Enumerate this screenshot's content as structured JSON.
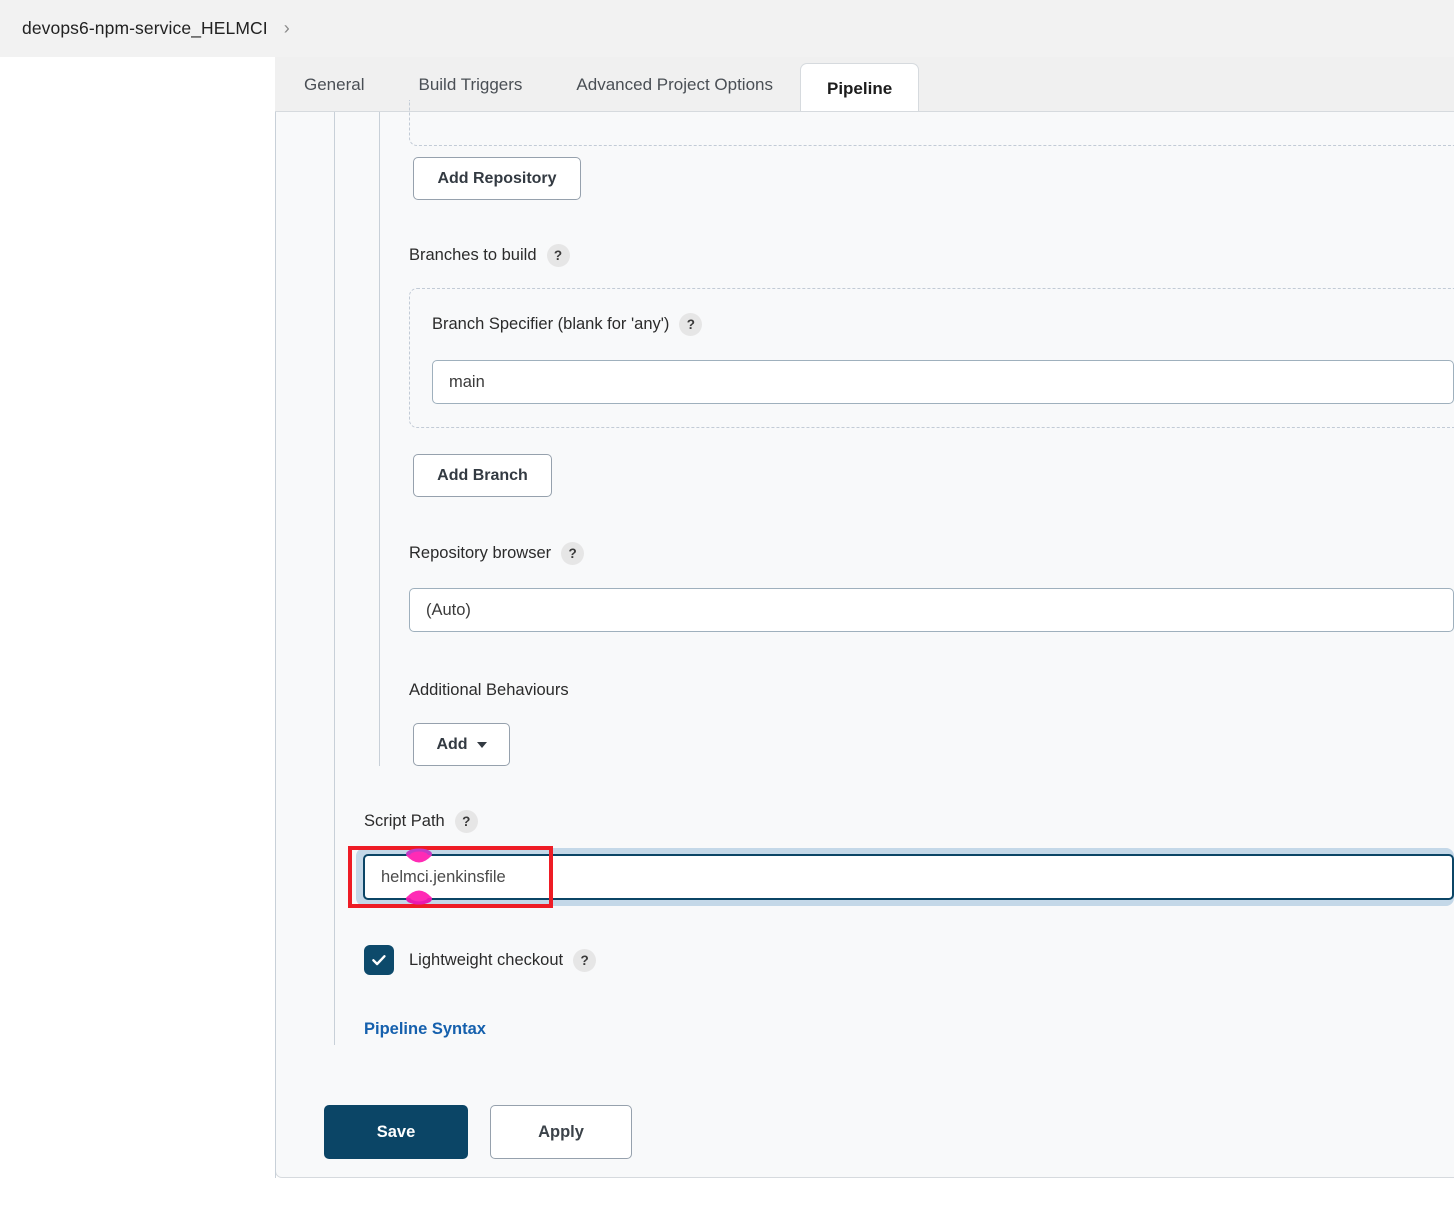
{
  "breadcrumb": {
    "item": "devops6-npm-service_HELMCI",
    "separator": "›"
  },
  "tabs": [
    {
      "label": "General",
      "active": false
    },
    {
      "label": "Build Triggers",
      "active": false
    },
    {
      "label": "Advanced Project Options",
      "active": false
    },
    {
      "label": "Pipeline",
      "active": true
    }
  ],
  "form": {
    "add_repository_label": "Add Repository",
    "branches_to_build_label": "Branches to build",
    "branch_specifier_label": "Branch Specifier (blank for 'any')",
    "branch_specifier_value": "main",
    "add_branch_label": "Add Branch",
    "repository_browser_label": "Repository browser",
    "repository_browser_value": "(Auto)",
    "additional_behaviours_label": "Additional Behaviours",
    "add_behaviour_label": "Add",
    "script_path_label": "Script Path",
    "script_path_value": "helmci.jenkinsfile",
    "lightweight_checkout_label": "Lightweight checkout",
    "lightweight_checkout_checked": true,
    "pipeline_syntax_link": "Pipeline Syntax",
    "help_badge": "?"
  },
  "actions": {
    "save_label": "Save",
    "apply_label": "Apply"
  },
  "colors": {
    "primary": "#0b4566",
    "link": "#1560ad",
    "annotation": "#ee1c25",
    "marker": "#ff2bb5",
    "panel_bg": "#f8f9fa",
    "focus_ring": "#c4d8e8"
  }
}
